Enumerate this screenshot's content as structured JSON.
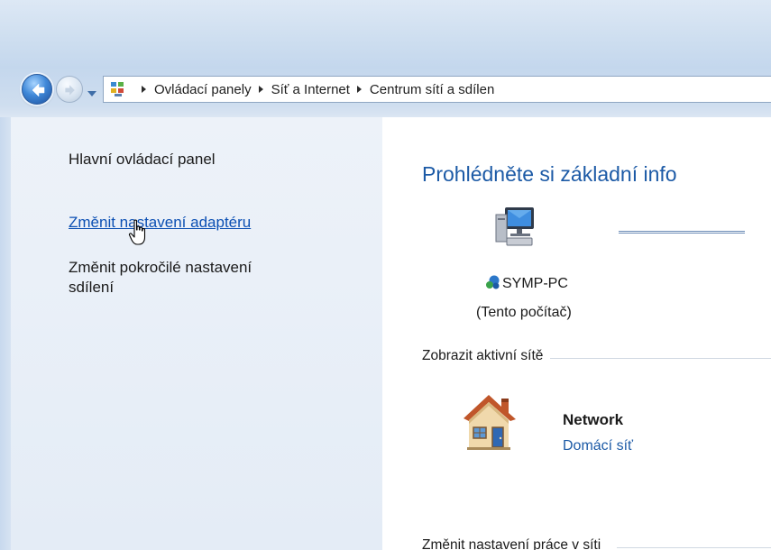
{
  "nav": {
    "breadcrumbs": [
      "Ovládací panely",
      "Síť a Internet",
      "Centrum sítí a sdílen"
    ]
  },
  "sidebar": {
    "home_link": "Hlavní ovládací panel",
    "items": [
      {
        "label": "Změnit nastavení adaptéru",
        "hovered": true
      },
      {
        "label_line1": "Změnit pokročilé nastavení",
        "label_line2": "sdílení"
      }
    ]
  },
  "main": {
    "title": "Prohlédněte si základní info",
    "computer": {
      "name": "SYMP-PC",
      "subtitle": "(Tento počítač)"
    },
    "active_networks_header": "Zobrazit aktivní sítě",
    "network": {
      "name": "Network",
      "type_link": "Domácí síť"
    },
    "change_settings_header": "Změnit nastavení práce v síti"
  },
  "colors": {
    "link": "#0b4fb3",
    "title": "#1c5aa6",
    "sidebar_bg": "#e8eef7"
  },
  "icons": [
    "back-arrow-icon",
    "forward-arrow-icon",
    "recent-pages-icon",
    "control-panel-icon",
    "hand-cursor-icon",
    "computer-icon",
    "network-sharing-icon",
    "home-network-icon"
  ]
}
